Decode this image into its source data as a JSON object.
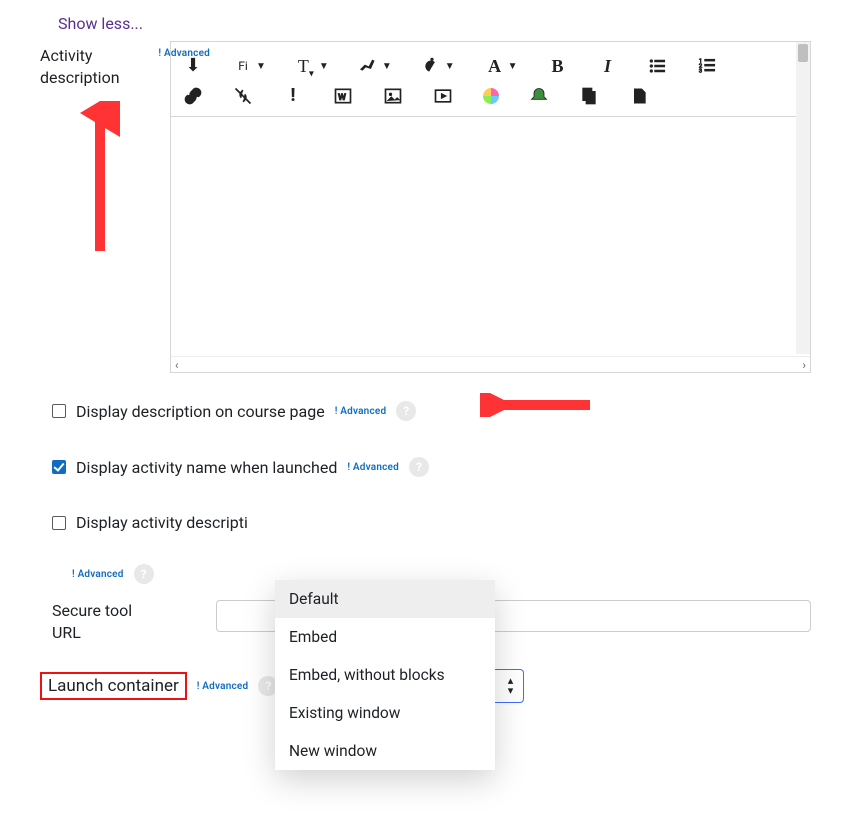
{
  "showLess": "Show less...",
  "activity": {
    "label": "Activity description",
    "advancedTag": "Advanced",
    "toolbarNames": {
      "toggle": "Toggle toolbar",
      "font": "Font family",
      "size": "Font size",
      "textColor": "Highlight color",
      "bulb": "Accessibility checker",
      "fontColor": "Font color",
      "bold": "Bold",
      "italic": "Italic",
      "ul": "Bulleted list",
      "ol": "Numbered list",
      "link": "Link",
      "unlink": "Unlink",
      "warn": "Screenreader helper",
      "word": "Word import",
      "image": "Insert image",
      "video": "Insert media",
      "kaltura": "Kaltura embed",
      "record": "Record",
      "files": "Manage files",
      "paste": "Paste"
    }
  },
  "checkboxes": {
    "displayCoursePage": "Display description on course page",
    "displayActivityName": "Display activity name when launched",
    "displayActivityDesc": "Display activity descripti"
  },
  "advancedTag": "Advanced",
  "secureToolUrl": {
    "label": "Secure tool URL",
    "value": ""
  },
  "launchContainer": {
    "label": "Launch container",
    "selected": "Default",
    "options": [
      "Default",
      "Embed",
      "Embed, without blocks",
      "Existing window",
      "New window"
    ]
  }
}
